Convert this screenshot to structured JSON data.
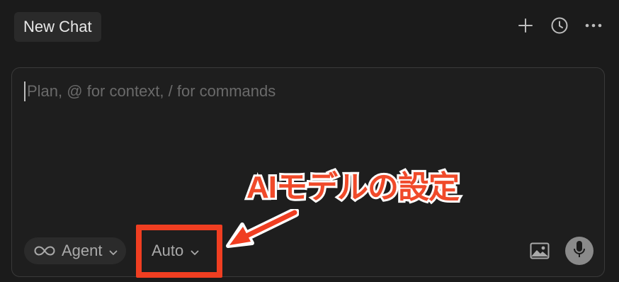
{
  "header": {
    "tab_title": "New Chat",
    "actions": [
      {
        "name": "plus-icon"
      },
      {
        "name": "history-clock-icon"
      },
      {
        "name": "more-dots-icon"
      }
    ]
  },
  "composer": {
    "placeholder": "Plan, @ for context, / for commands",
    "value": "",
    "mode": {
      "label": "Agent",
      "icon": "infinity-icon"
    },
    "model": {
      "label": "Auto",
      "icon": "chevron-down-icon"
    },
    "attach_icon": "image-icon",
    "voice_icon": "microphone-icon"
  },
  "annotation": {
    "text": "AIモデルの設定",
    "color": "#f04a2a"
  }
}
